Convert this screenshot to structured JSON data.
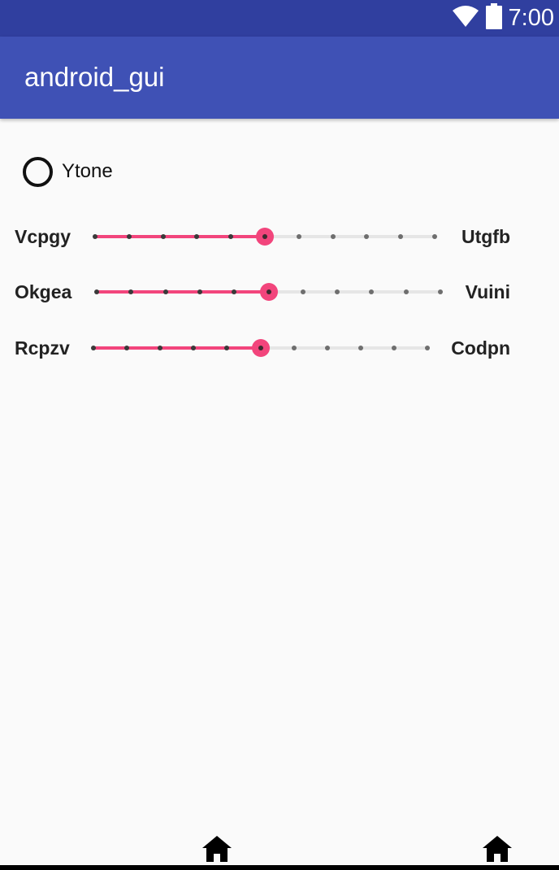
{
  "status_bar": {
    "time": "7:00",
    "icons": [
      "wifi-icon",
      "battery-icon"
    ],
    "color": "#303F9F"
  },
  "app_bar": {
    "title": "android_gui",
    "color": "#3F51B5"
  },
  "radio": {
    "label": "Ytone",
    "checked": false
  },
  "sliders": [
    {
      "left_label": "Vcpgy",
      "right_label": "Utgfb",
      "steps": 10,
      "value": 5
    },
    {
      "left_label": "Okgea",
      "right_label": "Vuini",
      "steps": 10,
      "value": 5
    },
    {
      "left_label": "Rcpzv",
      "right_label": "Codpn",
      "steps": 10,
      "value": 5
    }
  ],
  "accent_color": "#F2457C",
  "nav": {
    "icons": [
      "home-icon",
      "home-icon"
    ]
  }
}
